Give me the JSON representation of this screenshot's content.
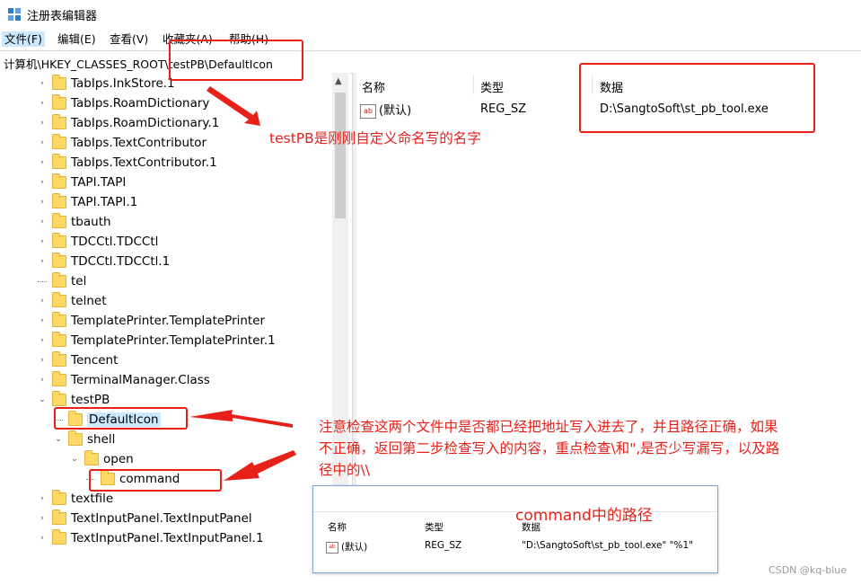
{
  "window": {
    "title": "注册表编辑器"
  },
  "menu": [
    "文件(F)",
    "编辑(E)",
    "查看(V)",
    "收藏夹(A)",
    "帮助(H)"
  ],
  "address": "计算机\\HKEY_CLASSES_ROOT\\testPB\\DefaultIcon",
  "tree": [
    {
      "label": "TabIps.InkStore.1",
      "level": 0,
      "expander": "›"
    },
    {
      "label": "TabIps.RoamDictionary",
      "level": 0,
      "expander": "›"
    },
    {
      "label": "TabIps.RoamDictionary.1",
      "level": 0,
      "expander": "›"
    },
    {
      "label": "TabIps.TextContributor",
      "level": 0,
      "expander": "›"
    },
    {
      "label": "TabIps.TextContributor.1",
      "level": 0,
      "expander": "›"
    },
    {
      "label": "TAPI.TAPI",
      "level": 0,
      "expander": "›"
    },
    {
      "label": "TAPI.TAPI.1",
      "level": 0,
      "expander": "›"
    },
    {
      "label": "tbauth",
      "level": 0,
      "expander": "›"
    },
    {
      "label": "TDCCtl.TDCCtl",
      "level": 0,
      "expander": "›"
    },
    {
      "label": "TDCCtl.TDCCtl.1",
      "level": 0,
      "expander": "›"
    },
    {
      "label": "tel",
      "level": 0,
      "expander": ""
    },
    {
      "label": "telnet",
      "level": 0,
      "expander": "›"
    },
    {
      "label": "TemplatePrinter.TemplatePrinter",
      "level": 0,
      "expander": "›"
    },
    {
      "label": "TemplatePrinter.TemplatePrinter.1",
      "level": 0,
      "expander": "›"
    },
    {
      "label": "Tencent",
      "level": 0,
      "expander": "›"
    },
    {
      "label": "TerminalManager.Class",
      "level": 0,
      "expander": "›"
    },
    {
      "label": "testPB",
      "level": 0,
      "expander": "⌄"
    },
    {
      "label": "DefaultIcon",
      "level": 1,
      "expander": "",
      "selected": true
    },
    {
      "label": "shell",
      "level": 1,
      "expander": "⌄"
    },
    {
      "label": "open",
      "level": 2,
      "expander": "⌄"
    },
    {
      "label": "command",
      "level": 3,
      "expander": ""
    },
    {
      "label": "textfile",
      "level": 0,
      "expander": "›"
    },
    {
      "label": "TextInputPanel.TextInputPanel",
      "level": 0,
      "expander": "›"
    },
    {
      "label": "TextInputPanel.TextInputPanel.1",
      "level": 0,
      "expander": "›"
    }
  ],
  "list": {
    "headers": {
      "name": "名称",
      "type": "类型",
      "data": "数据"
    },
    "rows": [
      {
        "icon": "ab",
        "name": "(默认)",
        "type": "REG_SZ",
        "data": "D:\\SangtoSoft\\st_pb_tool.exe"
      }
    ]
  },
  "annotations": {
    "name_note": "testPB是刚刚自定义命名写的名字",
    "check_note_1": "注意检查这两个文件中是否都已经把地址写入进去了，并且路径正确，如果",
    "check_note_2": "不正确，返回第二步检查写入的内容，重点检查\\和\",是否少写漏写，以及路",
    "check_note_3": "径中的\\\\"
  },
  "inset": {
    "title": "command中的路径",
    "headers": {
      "name": "名称",
      "type": "类型",
      "data": "数据"
    },
    "row": {
      "icon": "ab",
      "name": "(默认)",
      "type": "REG_SZ",
      "data": "\"D:\\SangtoSoft\\st_pb_tool.exe\" \"%1\""
    }
  },
  "watermark": "CSDN @kq-blue",
  "colors": {
    "annotation_red": "#e8201a",
    "selection": "#cce8ff"
  }
}
